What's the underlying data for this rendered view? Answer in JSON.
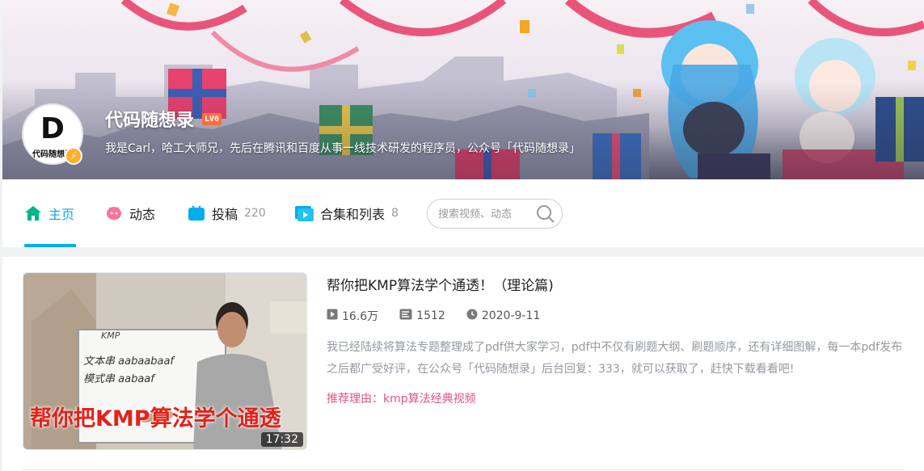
{
  "profile": {
    "name": "代码随想录",
    "level": "LV6",
    "signature": "我是Carl，哈工大师兄，先后在腾讯和百度从事一线技术研发的程序员，公众号「代码随想录」",
    "avatar_letter": "D",
    "avatar_caption": "代码随想录"
  },
  "nav": {
    "tabs": [
      {
        "label": "主页",
        "count": "",
        "icon": "home-icon",
        "active": true
      },
      {
        "label": "动态",
        "count": "",
        "icon": "activity-icon",
        "active": false
      },
      {
        "label": "投稿",
        "count": "220",
        "icon": "upload-icon",
        "active": false
      },
      {
        "label": "合集和列表",
        "count": "8",
        "icon": "collection-icon",
        "active": false
      }
    ],
    "search_placeholder": "搜索视频、动态"
  },
  "featured": {
    "title": "帮你把KMP算法学个通透！（理论篇)",
    "plays": "16.6万",
    "danmaku": "1512",
    "date": "2020-9-11",
    "description": "我已经陆续将算法专题整理成了pdf供大家学习，pdf中不仅有刷题大纲、刷题顺序，还有详细图解，每一本pdf发布之后都广受好评，在公众号「代码随想录」后台回复：333，就可以获取了，赶快下载看看吧!",
    "reason": "推荐理由：kmp算法经典视频",
    "thumbnail_title": "帮你把KMP算法学个通透",
    "duration": "17:32",
    "board_lines": [
      "KMP",
      "文本串 aabaabaaf",
      "模式串 aabaaf"
    ]
  },
  "colors": {
    "accent": "#00aeec",
    "reason": "#e0548a",
    "level_badge": "#ff6c3e",
    "thumb_title": "#e32219"
  }
}
